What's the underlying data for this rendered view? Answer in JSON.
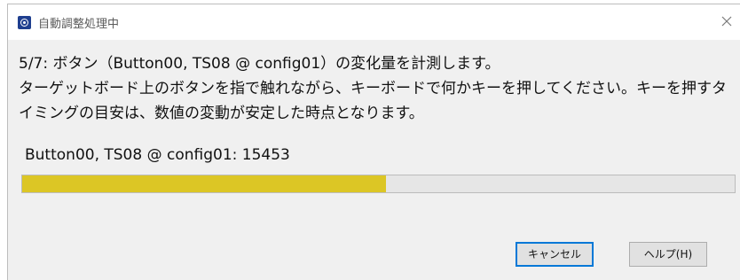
{
  "dialog": {
    "title": "自動調整処理中",
    "message_lines": [
      "5/7: ボタン（Button00, TS08 @ config01）の変化量を計測します。",
      "ターゲットボード上のボタンを指で触れながら、キーボードで何かキーを押してください。キーを押すタ",
      "イミングの目安は、数値の変動が安定した時点となります。"
    ],
    "value_label": "Button00, TS08 @ config01: 15453",
    "progress_percent": 51,
    "progress_color": "#dcc625",
    "cancel_label": "キャンセル",
    "help_label": "ヘルプ(H)",
    "icons": {
      "app": "app-icon",
      "close": "close-icon"
    }
  }
}
